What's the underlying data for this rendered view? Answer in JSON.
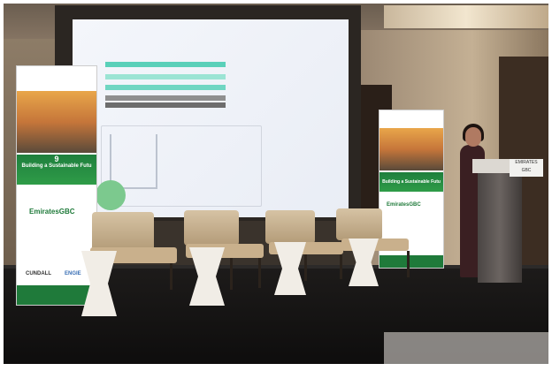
{
  "scene": "conference-stage",
  "banner_left": {
    "edition": "9",
    "headline": "Building a Sustainable Futu",
    "brand": "EmiratesGBC",
    "sponsor_1": "CUNDALL",
    "sponsor_2": "ENGIE"
  },
  "banner_right": {
    "headline": "Building a Sustainable Futu",
    "brand": "EmiratesGBC"
  },
  "podium_sign": {
    "line_1": "EMIRATES",
    "line_2": "GBC"
  },
  "colors": {
    "banner_green": "#1f7a3a",
    "screen_teal": "#5ad0b9",
    "chair": "#c9b08c"
  }
}
